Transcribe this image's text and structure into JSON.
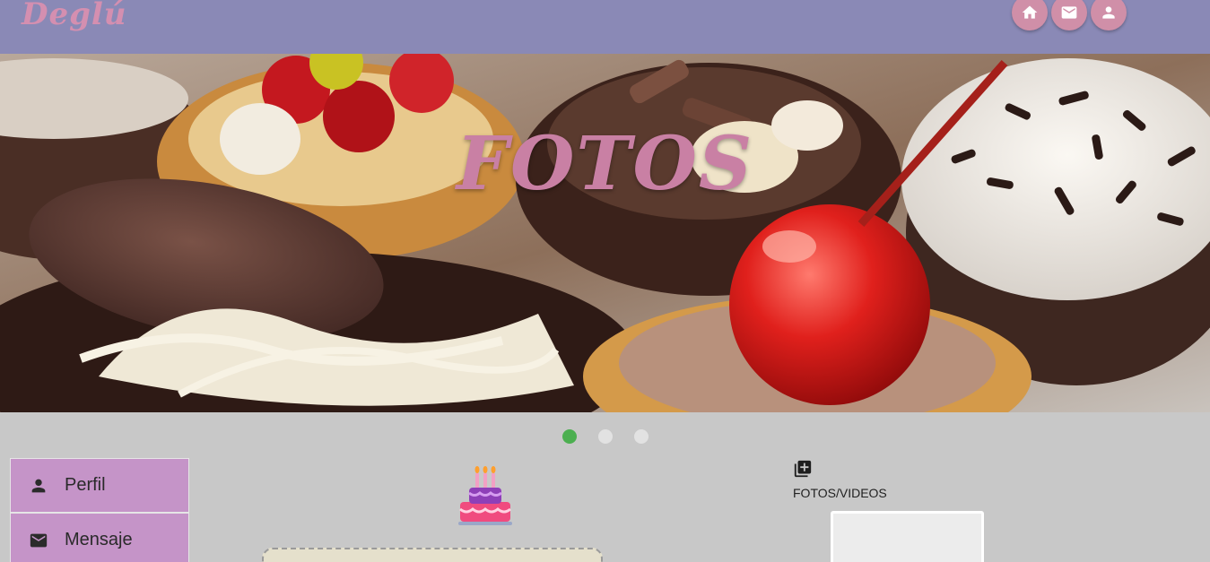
{
  "header": {
    "logo": "Deglú",
    "nav": [
      {
        "icon": "home-icon"
      },
      {
        "icon": "mail-icon"
      },
      {
        "icon": "user-icon"
      }
    ]
  },
  "hero": {
    "title": "FOTOS",
    "image_subject": "dessert-tarts"
  },
  "carousel": {
    "slides": 3,
    "active_index": 0,
    "active_color": "#4caf50",
    "inactive_color": "#e2e2e2"
  },
  "sidebar": {
    "items": [
      {
        "label": "Perfil",
        "icon": "person-icon"
      },
      {
        "label": "Mensaje",
        "icon": "mail-icon"
      }
    ]
  },
  "main": {
    "icon": "birthday-cake-icon"
  },
  "media": {
    "add_icon": "add-photo-library-icon",
    "label": "FOTOS/VIDEOS"
  },
  "colors": {
    "header_bg": "#8a89b6",
    "accent_pink": "#d08fa8",
    "sidebar_bg": "#c594c8",
    "page_bg": "#c8c8c8"
  }
}
